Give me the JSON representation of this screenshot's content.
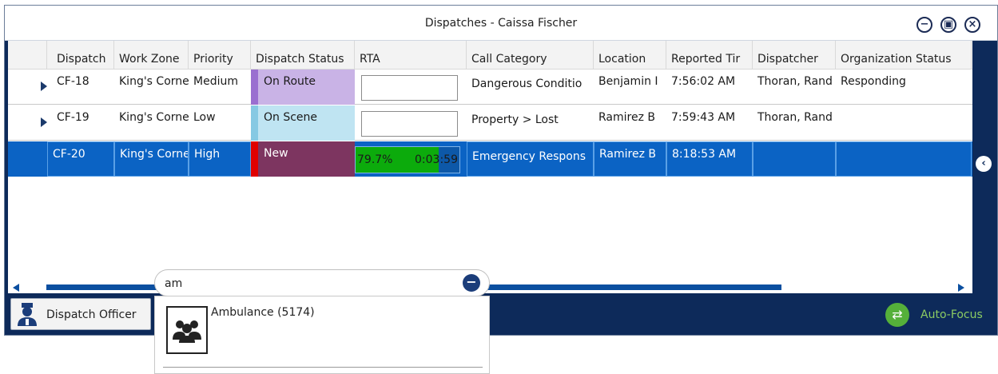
{
  "window": {
    "title": "Dispatches - Caissa Fischer"
  },
  "titlebar_buttons": [
    "minimize-icon",
    "restore-icon",
    "close-icon"
  ],
  "columns": [
    "Dispatch",
    "Work Zone",
    "Priority",
    "Dispatch Status",
    "RTA",
    "Call Category",
    "Location",
    "Reported Tir",
    "Dispatcher",
    "Organization Status"
  ],
  "rows": [
    {
      "dispatch": "CF-18",
      "work_zone": "King's Corne",
      "priority": "Medium",
      "status": "On Route",
      "status_color": "#c9b3e6",
      "status_strip": "#9a6fd0",
      "rta": "",
      "call_category": "Dangerous Conditio",
      "location": "Benjamin I",
      "reported": "7:56:02 AM",
      "dispatcher": "Thoran, Rand",
      "org_status": "Responding"
    },
    {
      "dispatch": "CF-19",
      "work_zone": "King's Corne",
      "priority": "Low",
      "status": "On Scene",
      "status_color": "#bfe4f2",
      "status_strip": "#86c9e3",
      "rta": "",
      "call_category": "Property > Lost",
      "location": "Ramirez B",
      "reported": "7:59:43 AM",
      "dispatcher": "Thoran, Rand",
      "org_status": ""
    },
    {
      "dispatch": "CF-20",
      "work_zone": "King's Corne",
      "priority": "High",
      "status": "New",
      "status_color": "#7d3560",
      "status_strip": "#e00000",
      "rta_percent": "79.7%",
      "rta_time": "0:03:59",
      "rta_fill": 0.797,
      "call_category": "Emergency Respons",
      "location": "Ramirez B",
      "reported": "8:18:53 AM",
      "dispatcher": "",
      "org_status": ""
    }
  ],
  "officer": {
    "label": "Dispatch Officer"
  },
  "autofocus": {
    "label": "Auto-Focus"
  },
  "search": {
    "value": "am"
  },
  "dropdown": {
    "items": [
      {
        "label": "Ambulance (5174)"
      }
    ]
  }
}
